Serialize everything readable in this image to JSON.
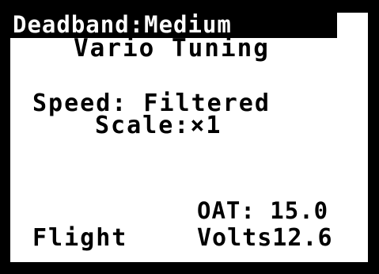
{
  "screen": {
    "title": "Vario Tuning",
    "menu": {
      "speed": "Speed: Filtered",
      "scale": "Scale:×1",
      "deadband": "Deadband:Medium"
    },
    "status": {
      "oat": "OAT: 15.0",
      "mode": "Flight",
      "volts": "Volts12.6"
    }
  },
  "colors": {
    "background": "#ffffff",
    "foreground": "#000000",
    "highlight": "#000000"
  }
}
